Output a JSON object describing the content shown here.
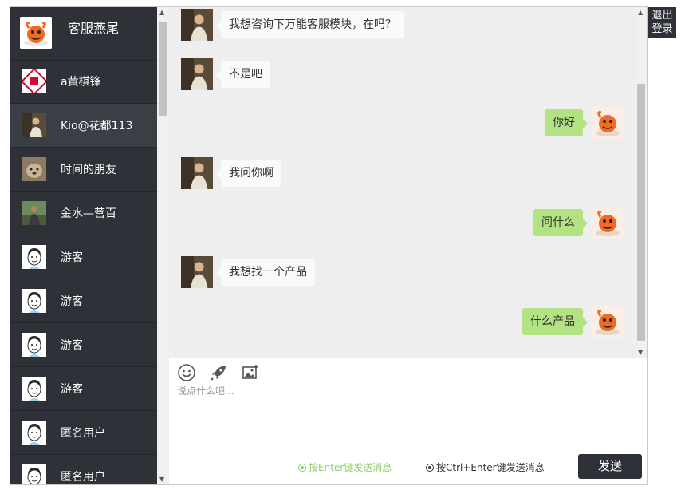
{
  "user": {
    "name": "客服燕尾"
  },
  "contacts": [
    {
      "name": "a黄棋锋",
      "avatar": "seal"
    },
    {
      "name": "Kio@花都113",
      "avatar": "photo-man",
      "active": true
    },
    {
      "name": "时间的朋友",
      "avatar": "photo-dog"
    },
    {
      "name": "金水—营百",
      "avatar": "photo-outdoor"
    },
    {
      "name": "游客",
      "avatar": "cartoon-face"
    },
    {
      "name": "游客",
      "avatar": "cartoon-face"
    },
    {
      "name": "游客",
      "avatar": "cartoon-face"
    },
    {
      "name": "游客",
      "avatar": "cartoon-face"
    },
    {
      "name": "匿名用户",
      "avatar": "cartoon-face"
    },
    {
      "name": "匿名用户",
      "avatar": "cartoon-face"
    }
  ],
  "messages": [
    {
      "side": "left",
      "text": "我想咨询下万能客服模块，在吗？"
    },
    {
      "side": "left",
      "text": "不是吧"
    },
    {
      "side": "right",
      "text": "你好"
    },
    {
      "side": "left",
      "text": "我问你啊"
    },
    {
      "side": "right",
      "text": "问什么"
    },
    {
      "side": "left",
      "text": "我想找一个产品"
    },
    {
      "side": "right",
      "text": "什么产品"
    }
  ],
  "composer": {
    "placeholder": "说点什么吧...",
    "tools": [
      "smiley-icon",
      "rocket-icon",
      "image-icon"
    ],
    "enter_option": "按Enter键发送消息",
    "ctrl_enter_option": "按Ctrl+Enter键发送消息",
    "send_label": "发送"
  },
  "logout": {
    "line1": "退出",
    "line2": "登录"
  },
  "colors": {
    "sidebar": "#2e3238",
    "bubble_self": "#b2e281",
    "bubble_other": "#fafafa",
    "chat_bg": "#eeeeee"
  }
}
